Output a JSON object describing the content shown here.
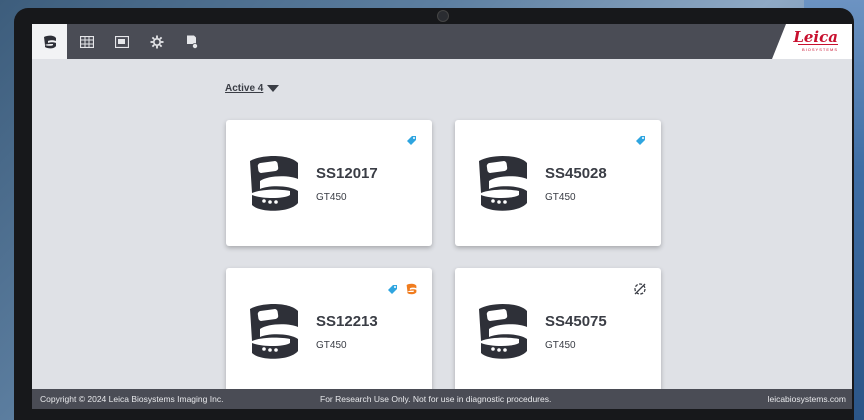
{
  "nav": {
    "items": [
      {
        "id": "instruments",
        "icon": "instrument-icon",
        "active": true
      },
      {
        "id": "grid",
        "icon": "grid-icon",
        "active": false
      },
      {
        "id": "image",
        "icon": "image-icon",
        "active": false
      },
      {
        "id": "settings",
        "icon": "gear-icon",
        "active": false
      },
      {
        "id": "report",
        "icon": "report-icon",
        "active": false
      }
    ],
    "logo": {
      "text": "Leica",
      "subtext": "BIOSYSTEMS",
      "color": "#c8102e"
    }
  },
  "filter": {
    "label": "Active 4"
  },
  "cards": [
    {
      "name": "SS12017",
      "model": "GT450",
      "status_icons": [
        "tag-icon"
      ]
    },
    {
      "name": "SS45028",
      "model": "GT450",
      "status_icons": [
        "tag-icon"
      ]
    },
    {
      "name": "SS12213",
      "model": "GT450",
      "status_icons": [
        "tag-icon",
        "alert-scanner-icon"
      ]
    },
    {
      "name": "SS45075",
      "model": "GT450",
      "status_icons": [
        "disconnected-icon"
      ]
    }
  ],
  "footer": {
    "copyright": "Copyright © 2024 Leica Biosystems Imaging Inc.",
    "disclaimer": "For Research Use Only.  Not for use in diagnostic procedures.",
    "website": "leicabiosystems.com"
  },
  "colors": {
    "topbar": "#4a4c55",
    "accent_blue": "#2fa5e0",
    "accent_orange": "#f07c1e",
    "text_dark": "#3a3d45"
  }
}
